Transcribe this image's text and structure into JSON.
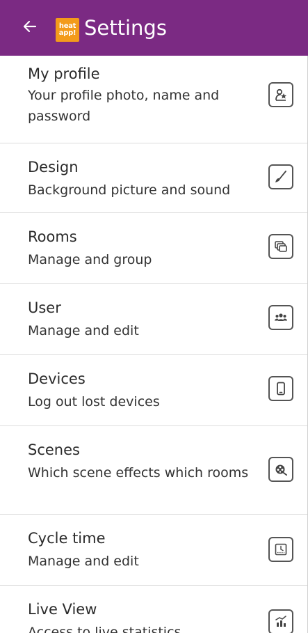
{
  "header": {
    "back_icon": "arrow-left-icon",
    "logo_line1": "heat",
    "logo_line2": "app!",
    "title": "Settings",
    "bg_color": "#7b2a83",
    "logo_color": "#f39b1b"
  },
  "settings": [
    {
      "title": "My profile",
      "subtitle": "Your profile photo, name and password",
      "icon": "profile-star-icon"
    },
    {
      "title": "Design",
      "subtitle": "Background picture and sound",
      "icon": "brush-icon"
    },
    {
      "title": "Rooms",
      "subtitle": "Manage and group",
      "icon": "rooms-stack-icon"
    },
    {
      "title": "User",
      "subtitle": "Manage and edit",
      "icon": "users-group-icon"
    },
    {
      "title": "Devices",
      "subtitle": "Log out lost devices",
      "icon": "phone-device-icon"
    },
    {
      "title": "Scenes",
      "subtitle": "Which scene effects which rooms",
      "icon": "scene-film-icon"
    },
    {
      "title": "Cycle time",
      "subtitle": "Manage and edit",
      "icon": "cycle-time-icon"
    },
    {
      "title": "Live View",
      "subtitle": "Access to live statistics",
      "icon": "live-chart-icon"
    }
  ]
}
